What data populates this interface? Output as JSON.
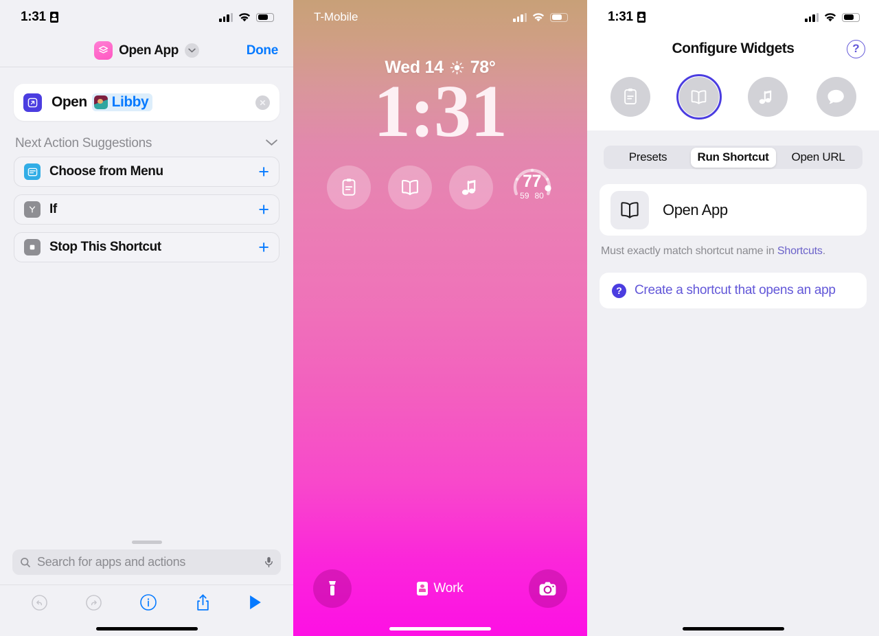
{
  "panel1": {
    "statusbar": {
      "time": "1:31",
      "lock_icon": "portrait-orientation-lock-icon",
      "signal_icon": "cellular-bars-icon",
      "wifi_icon": "wifi-icon",
      "battery_icon": "battery-icon"
    },
    "header": {
      "app_icon": "shortcuts-stack-icon",
      "title": "Open App",
      "chevron_icon": "chevron-down-icon",
      "done_label": "Done"
    },
    "action": {
      "icon": "open-app-arrow-icon",
      "verb": "Open",
      "token_icon": "libby-app-icon",
      "token_label": "Libby",
      "clear_icon": "clear-circle-icon"
    },
    "suggestions_header": {
      "title": "Next Action Suggestions",
      "collapse_icon": "chevron-down-icon"
    },
    "suggestions": [
      {
        "label": "Choose from Menu",
        "icon": "menu-list-icon",
        "icon_color": "#32ade6",
        "add_icon": "plus-icon"
      },
      {
        "label": "If",
        "icon": "branch-icon",
        "icon_color": "#8e8e93",
        "add_icon": "plus-icon"
      },
      {
        "label": "Stop This Shortcut",
        "icon": "stop-square-icon",
        "icon_color": "#8e8e93",
        "add_icon": "plus-icon"
      }
    ],
    "search": {
      "placeholder": "Search for apps and actions",
      "search_icon": "search-icon",
      "mic_icon": "microphone-icon"
    },
    "toolbar": [
      {
        "name": "undo-button",
        "icon": "undo-arrow-icon",
        "enabled": false
      },
      {
        "name": "redo-button",
        "icon": "redo-arrow-icon",
        "enabled": false
      },
      {
        "name": "info-button",
        "icon": "info-circle-icon",
        "enabled": true
      },
      {
        "name": "share-button",
        "icon": "share-icon",
        "enabled": true
      },
      {
        "name": "run-button",
        "icon": "play-triangle-icon",
        "enabled": true
      }
    ]
  },
  "panel2": {
    "statusbar": {
      "carrier": "T-Mobile",
      "signal_icon": "cellular-bars-icon",
      "wifi_icon": "wifi-icon",
      "battery_icon": "battery-icon"
    },
    "date": "Wed 14",
    "weather_icon": "sun-icon",
    "temperature": "78°",
    "time": "1:31",
    "widgets": [
      {
        "name": "notes-widget",
        "icon": "clipboard-note-icon"
      },
      {
        "name": "books-widget",
        "icon": "open-book-icon"
      },
      {
        "name": "music-widget",
        "icon": "music-notes-icon"
      },
      {
        "name": "temperature-widget",
        "icon": "gauge-icon",
        "value": "77",
        "low": "59",
        "high": "80"
      }
    ],
    "bottom": {
      "flashlight_icon": "flashlight-icon",
      "focus_label": "Work",
      "focus_icon": "work-badge-icon",
      "camera_icon": "camera-icon"
    }
  },
  "panel3": {
    "statusbar": {
      "time": "1:31",
      "lock_icon": "portrait-orientation-lock-icon",
      "signal_icon": "cellular-bars-icon",
      "wifi_icon": "wifi-icon",
      "battery_icon": "battery-icon"
    },
    "header": {
      "title": "Configure Widgets",
      "help_label": "?",
      "help_icon": "question-circle-icon"
    },
    "slots": [
      {
        "name": "widget-slot-notes",
        "icon": "clipboard-note-icon",
        "selected": false
      },
      {
        "name": "widget-slot-books",
        "icon": "open-book-icon",
        "selected": true
      },
      {
        "name": "widget-slot-music",
        "icon": "music-notes-icon",
        "selected": false
      },
      {
        "name": "widget-slot-messages",
        "icon": "chat-bubble-icon",
        "selected": false
      }
    ],
    "segments": [
      {
        "label": "Presets",
        "active": false
      },
      {
        "label": "Run Shortcut",
        "active": true
      },
      {
        "label": "Open URL",
        "active": false
      }
    ],
    "row": {
      "icon": "open-book-icon",
      "label": "Open App"
    },
    "hint": {
      "text": "Must exactly match shortcut name in ",
      "link": "Shortcuts",
      "suffix": "."
    },
    "link_card": {
      "badge": "?",
      "label": "Create a shortcut that opens an app"
    }
  },
  "colors": {
    "ios_blue": "#067aff",
    "purple_accent": "#4b3de0",
    "gauge_pink": "#ffffff"
  }
}
